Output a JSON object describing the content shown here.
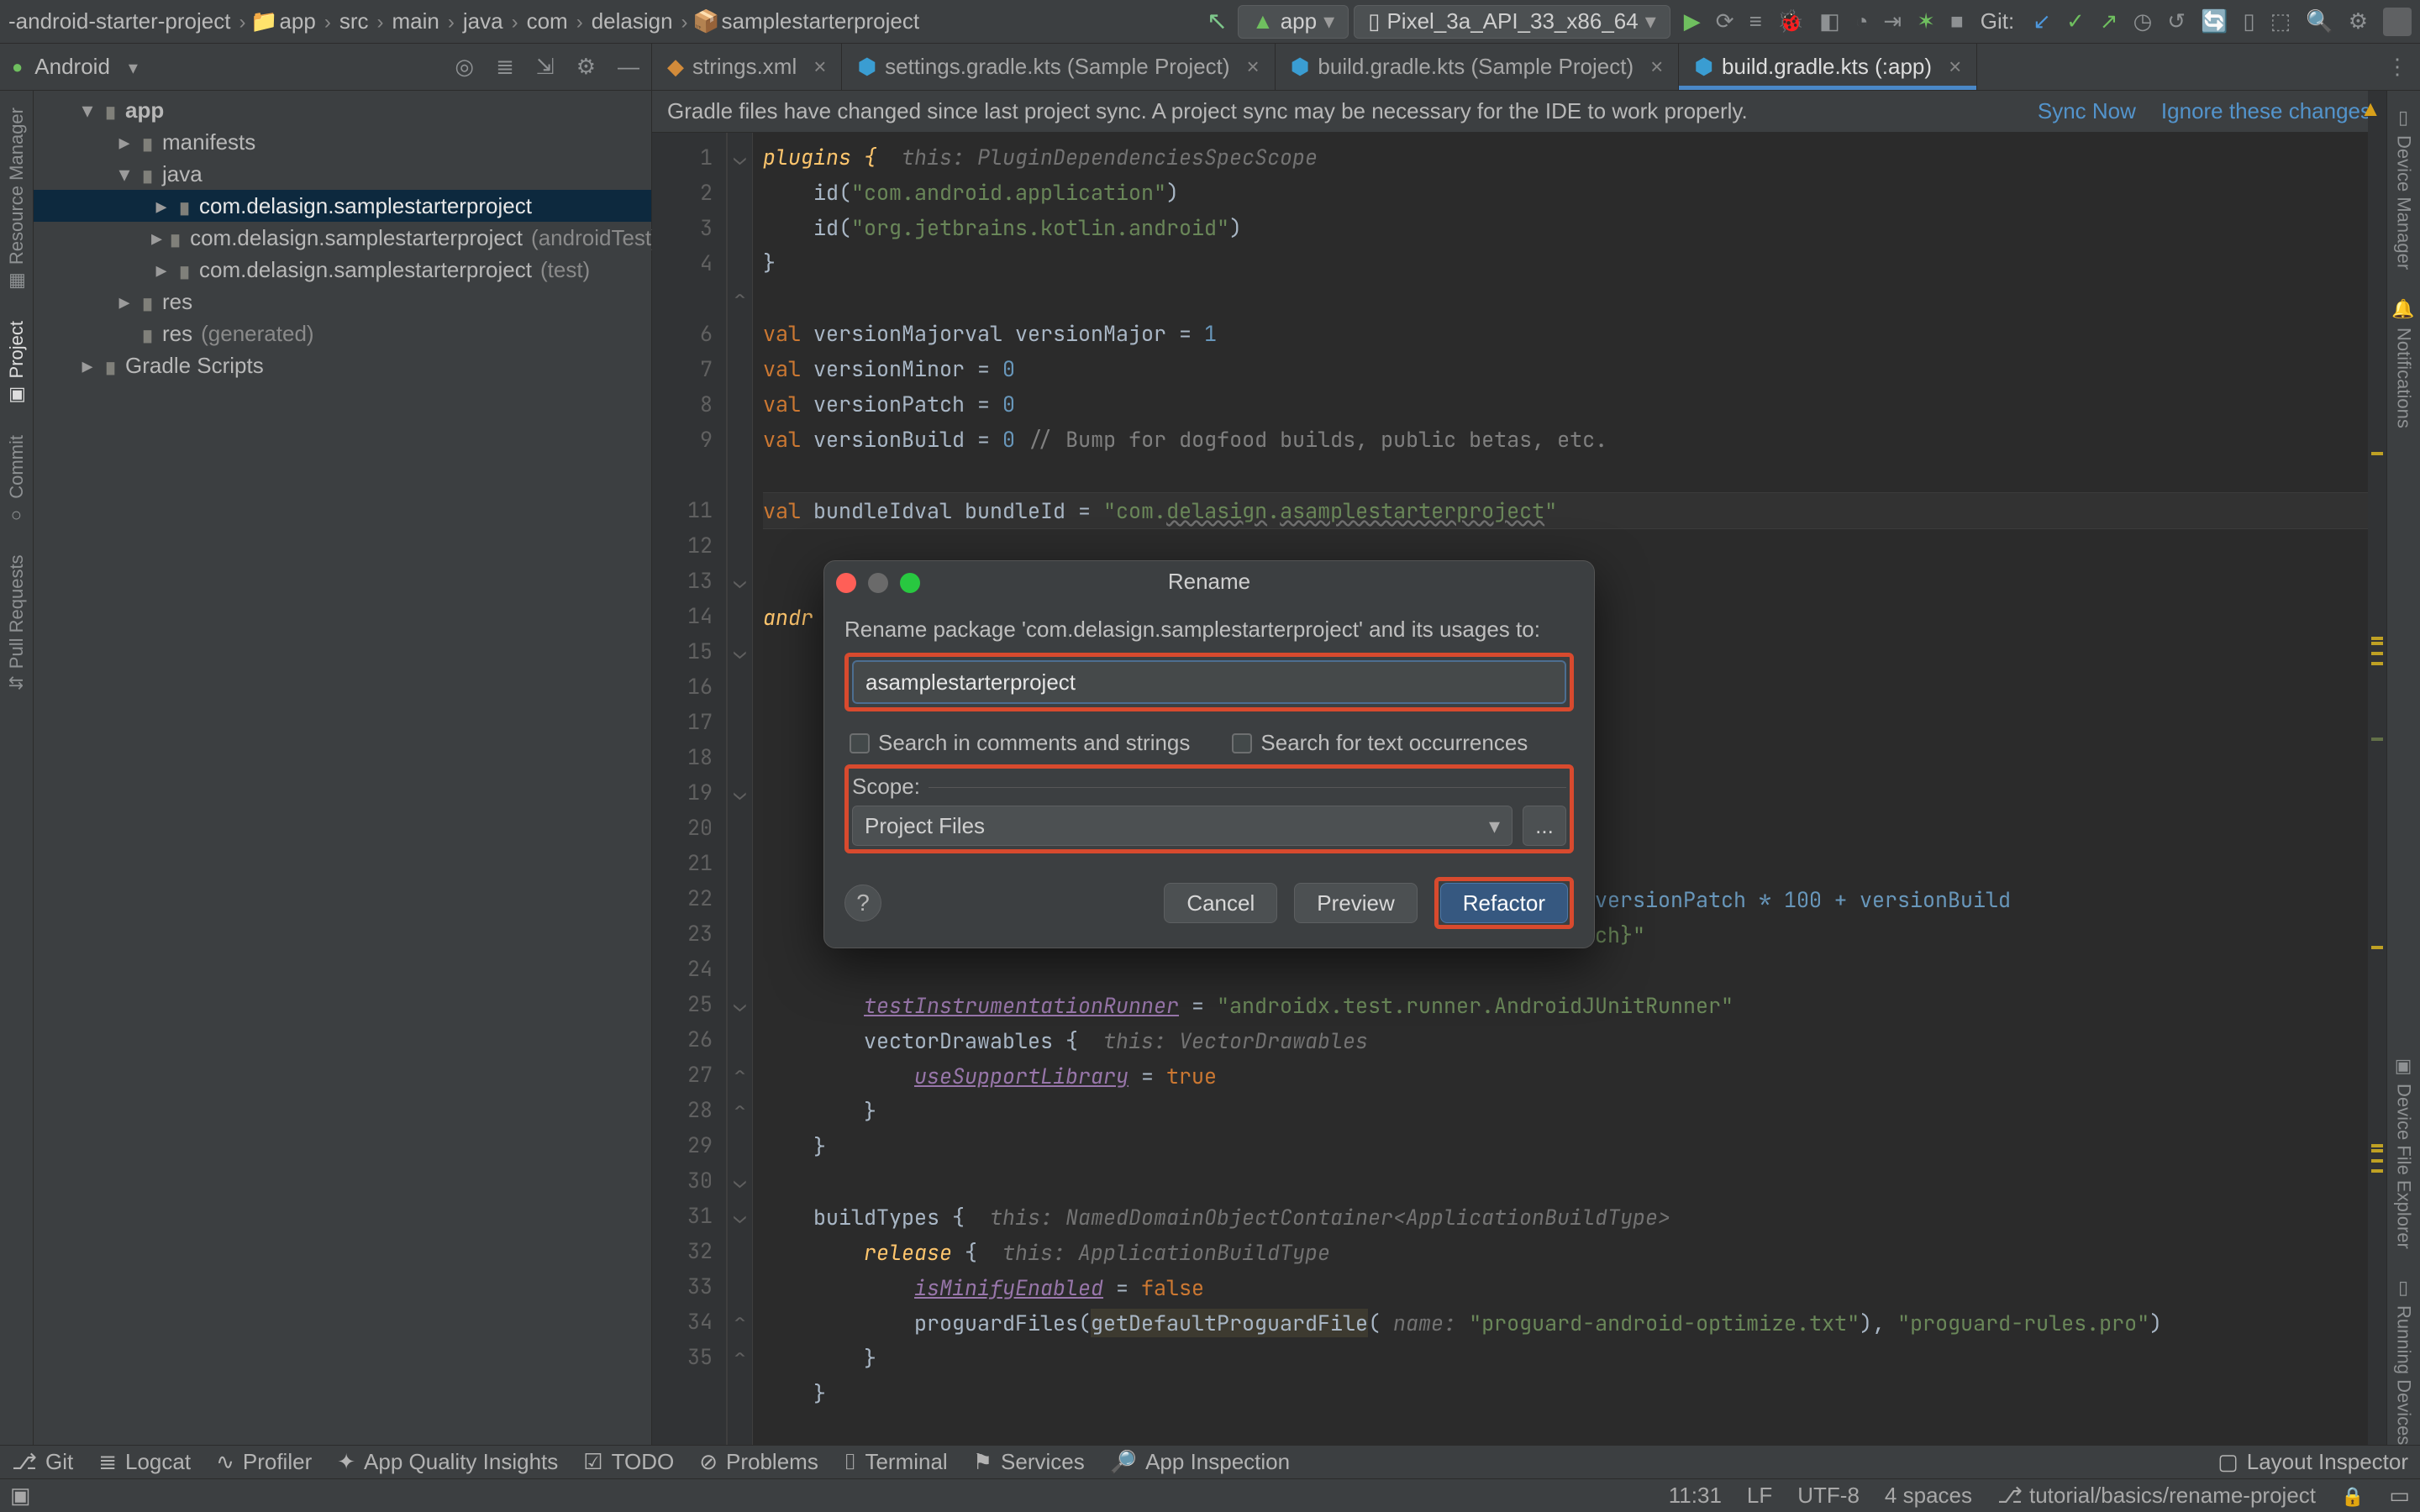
{
  "breadcrumbs": [
    "-android-starter-project",
    "app",
    "src",
    "main",
    "java",
    "com",
    "delasign",
    "samplestarterproject"
  ],
  "run": {
    "config": "app",
    "device": "Pixel_3a_API_33_x86_64"
  },
  "git_label": "Git:",
  "project_view": {
    "label": "Android",
    "tree": {
      "app": "app",
      "manifests": "manifests",
      "java": "java",
      "pkg_main": "com.delasign.samplestarterproject",
      "pkg_android_test": "com.delasign.samplestarterproject",
      "pkg_android_test_suffix": " (androidTest)",
      "pkg_test": "com.delasign.samplestarterproject",
      "pkg_test_suffix": " (test)",
      "res": "res",
      "res_gen": "res",
      "res_gen_suffix": " (generated)",
      "gradle_scripts": "Gradle Scripts"
    }
  },
  "tabs": {
    "t1": "strings.xml",
    "t2": "settings.gradle.kts (Sample Project)",
    "t3": "build.gradle.kts (Sample Project)",
    "t4": "build.gradle.kts (:app)"
  },
  "banner": {
    "msg": "Gradle files have changed since last project sync. A project sync may be necessary for the IDE to work properly.",
    "sync": "Sync Now",
    "ignore": "Ignore these changes"
  },
  "code": {
    "line1_a": "plugins {",
    "line1_hint": "  this: PluginDependenciesSpecScope",
    "line2_a": "    id(",
    "line2_str": "\"com.android.application\"",
    "line2_b": ")",
    "line3_a": "    id(",
    "line3_str": "\"org.jetbrains.kotlin.android\"",
    "line3_b": ")",
    "line4": "}",
    "line6": "val versionMajor = ",
    "line6_n": "1",
    "line7": "val versionMinor = ",
    "line7_n": "0",
    "line8": "val versionPatch = ",
    "line8_n": "0",
    "line9": "val versionBuild = ",
    "line9_n": "0",
    "line9_cmt": " // Bump for dogfood builds, public betas, etc.",
    "line11_a": "val bundleId = ",
    "line11_str_a": "\"com.",
    "line11_str_b": "delasign",
    "line11_str_c": ".",
    "line11_str_d": "asamplestarterproject",
    "line11_str_e": "\"",
    "line13": "andr",
    "line21_tail": "00 + versionPatch * 100 + versionBuild",
    "line22_tail": "onPatch}\"",
    "line24_a": "        ",
    "line24_fld": "testInstrumentationRunner",
    "line24_b": " = ",
    "line24_str": "\"androidx.test.runner.AndroidJUnitRunner\"",
    "line25_a": "        vectorDrawables {",
    "line25_hint": "  this: VectorDrawables",
    "line26_a": "            ",
    "line26_fld": "useSupportLibrary",
    "line26_b": " = ",
    "line26_kw": "true",
    "line27": "        }",
    "line28": "    }",
    "line30_a": "    buildTypes {",
    "line30_hint": "  this: NamedDomainObjectContainer<ApplicationBuildType>",
    "line31_a": "        ",
    "line31_fn": "release",
    "line31_b": " {",
    "line31_hint": "  this: ApplicationBuildType",
    "line32_a": "            ",
    "line32_fld": "isMinifyEnabled",
    "line32_b": " = ",
    "line32_kw": "false",
    "line33_a": "            proguardFiles(",
    "line33_fnbox": "getDefaultProguardFile",
    "line33_b": "( ",
    "line33_hint": "name:",
    "line33_str1": " \"proguard-android-optimize.txt\"",
    "line33_c": "), ",
    "line33_str2": "\"proguard-rules.pro\"",
    "line33_d": ")",
    "line34": "        }",
    "line35": "    }"
  },
  "dialog": {
    "title": "Rename",
    "prompt": "Rename package 'com.delasign.samplestarterproject' and its usages to:",
    "input": "asamplestarterproject",
    "chk1": "Search in comments and strings",
    "chk2": "Search for text occurrences",
    "scope_label": "Scope:",
    "scope_value": "Project Files",
    "more": "...",
    "help": "?",
    "cancel": "Cancel",
    "preview": "Preview",
    "refactor": "Refactor"
  },
  "left_toolwindows": {
    "resource_mgr": "Resource Manager",
    "project": "Project",
    "commit": "Commit",
    "pull_requests": "Pull Requests"
  },
  "right_toolwindows": {
    "device_mgr": "Device Manager",
    "notifications": "Notifications",
    "device_file": "Device File Explorer",
    "running_devs": "Running Devices"
  },
  "bottom_tools": {
    "git": "Git",
    "logcat": "Logcat",
    "profiler": "Profiler",
    "aqi": "App Quality Insights",
    "todo": "TODO",
    "problems": "Problems",
    "terminal": "Terminal",
    "services": "Services",
    "app_inspection": "App Inspection",
    "layout_inspector": "Layout Inspector"
  },
  "status": {
    "pos": "11:31",
    "lf": "LF",
    "enc": "UTF-8",
    "indent": "4 spaces",
    "branch": "tutorial/basics/rename-project"
  }
}
